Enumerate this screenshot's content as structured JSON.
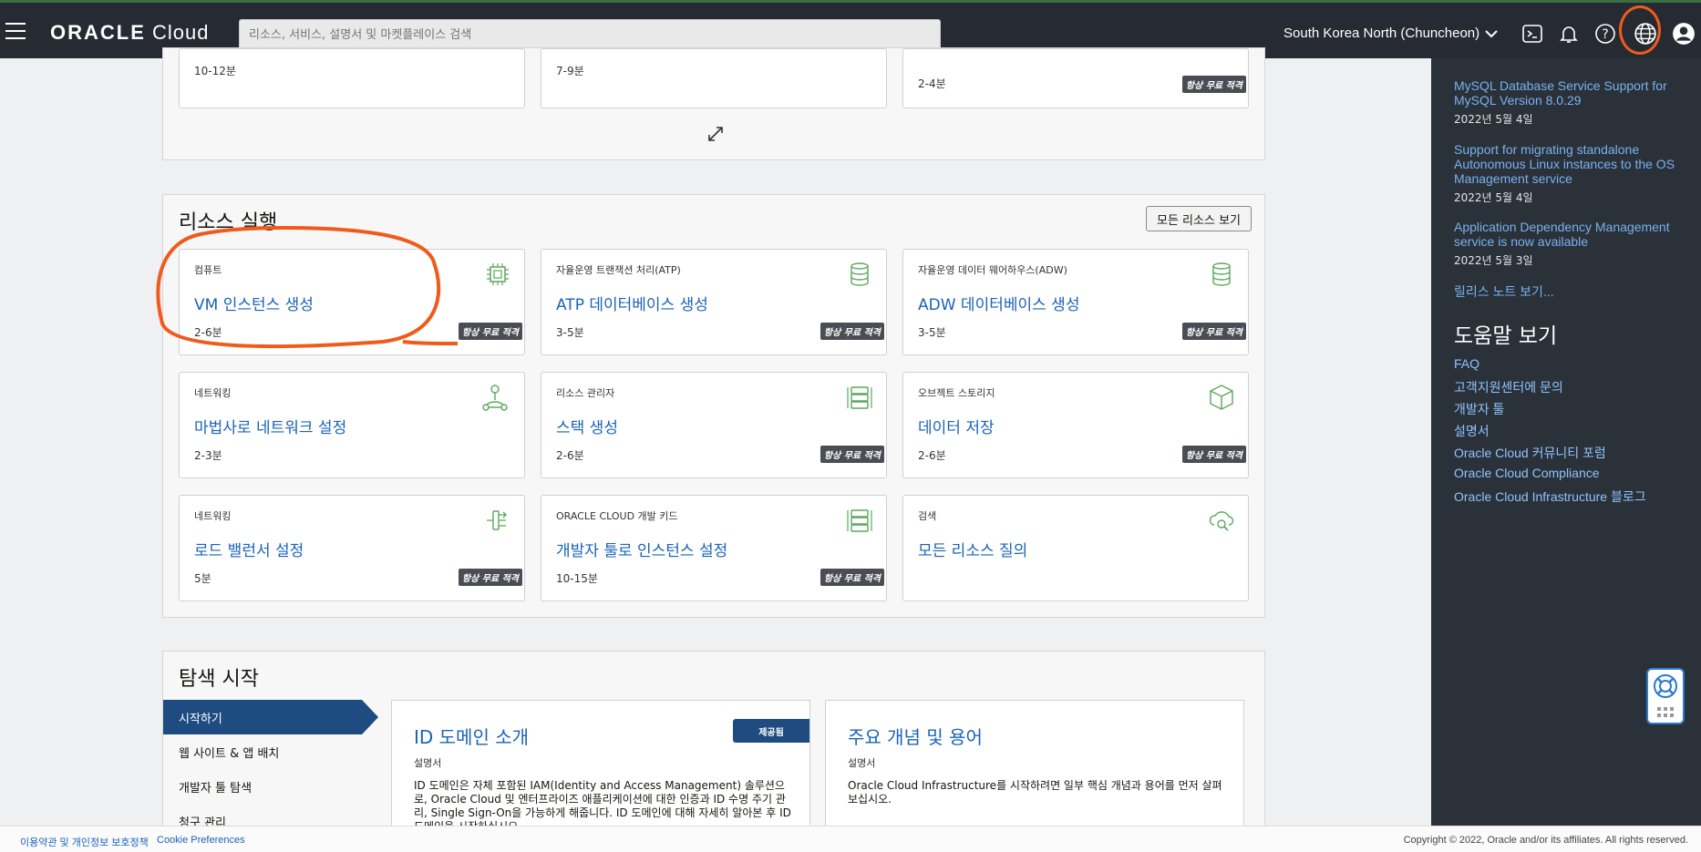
{
  "header": {
    "logo_strong": "ORACLE",
    "logo_light": " Cloud",
    "search_placeholder": "리소스, 서비스, 설명서 및 마켓플레이스 검색",
    "region": "South Korea North (Chuncheon)"
  },
  "explore_top": {
    "cards": [
      {
        "time": "10-12분"
      },
      {
        "time": "7-9분"
      },
      {
        "time": "2-4분",
        "badge": "항상 무료 적격"
      }
    ]
  },
  "launch": {
    "title": "리소스 실행",
    "view_all": "모든 리소스 보기",
    "cards": [
      {
        "category": "컴퓨트",
        "title": "VM 인스턴스 생성",
        "time": "2-6분",
        "badge": "항상 무료 적격",
        "icon": "chip-icon"
      },
      {
        "category": "자율운영 트랜잭션 처리(ATP)",
        "title": "ATP 데이터베이스 생성",
        "time": "3-5분",
        "badge": "항상 무료 적격",
        "icon": "database-icon"
      },
      {
        "category": "자율운영 데이터 웨어하우스(ADW)",
        "title": "ADW 데이터베이스 생성",
        "time": "3-5분",
        "badge": "항상 무료 적격",
        "icon": "database-icon"
      },
      {
        "category": "네트워킹",
        "title": "마법사로 네트워크 설정",
        "time": "2-3분",
        "badge": "",
        "icon": "network-icon"
      },
      {
        "category": "리소스 관리자",
        "title": "스택 생성",
        "time": "2-6분",
        "badge": "항상 무료 적격",
        "icon": "stack-icon"
      },
      {
        "category": "오브젝트 스토리지",
        "title": "데이터 저장",
        "time": "2-6분",
        "badge": "항상 무료 적격",
        "icon": "box-icon"
      },
      {
        "category": "네트워킹",
        "title": "로드 밸런서 설정",
        "time": "5분",
        "badge": "항상 무료 적격",
        "icon": "load-balancer-icon"
      },
      {
        "category": "ORACLE CLOUD 개발 키드",
        "title": "개발자 툴로 인스턴스 설정",
        "time": "10-15분",
        "badge": "항상 무료 적격",
        "icon": "stack-icon"
      },
      {
        "category": "검색",
        "title": "모든 리소스 질의",
        "time": "",
        "badge": "",
        "icon": "cloud-search-icon"
      }
    ]
  },
  "getting_started": {
    "title": "탐색 시작",
    "tabs": [
      "시작하기",
      "웹 사이트 & 앱 배치",
      "개발자 툴 탐색",
      "청구 관리"
    ],
    "docs": [
      {
        "title": "ID 도메인 소개",
        "type": "설명서",
        "badge": "제공됨",
        "desc": "ID 도메인은 자체 포함된 IAM(Identity and Access Management) 솔루션으로, Oracle Cloud 및 엔터프라이즈 애플리케이션에 대한 인증과 ID 수명 주기 관리, Single Sign-On을 가능하게 해줍니다. ID 도메인에 대해 자세히 알아본 후 ID 도메인을 시작하십시오."
      },
      {
        "title": "주요 개념 및 용어",
        "type": "설명서",
        "badge": "",
        "desc": "Oracle Cloud Infrastructure를 시작하려면 일부 핵심 개념과 용어를 먼저 살펴보십시오."
      }
    ]
  },
  "sidebar": {
    "news": [
      {
        "link": "MySQL Database Service Support for MySQL Version 8.0.29",
        "date": "2022년 5월 4일"
      },
      {
        "link": "Support for migrating standalone Autonomous Linux instances to the OS Management service",
        "date": "2022년 5월 4일"
      },
      {
        "link": "Application Dependency Management service is now available",
        "date": "2022년 5월 3일"
      }
    ],
    "release_notes": "릴리스 노트 보기...",
    "help_title": "도움말 보기",
    "help_links": [
      "FAQ",
      "고객지원센터에 문의",
      "개발자 툴",
      "설명서",
      "Oracle Cloud 커뮤니티 포럼",
      "Oracle Cloud Compliance",
      "Oracle Cloud Infrastructure 블로그"
    ]
  },
  "footer": {
    "terms": "이용약관 및 개인정보 보호정책",
    "cookies": "Cookie Preferences",
    "copyright": "Copyright © 2022, Oracle and/or its affiliates. All rights reserved."
  },
  "colors": {
    "accent": "#1a63b8",
    "annotation": "#f05a1a",
    "header": "#262b33",
    "sidebar": "#2b3139"
  }
}
